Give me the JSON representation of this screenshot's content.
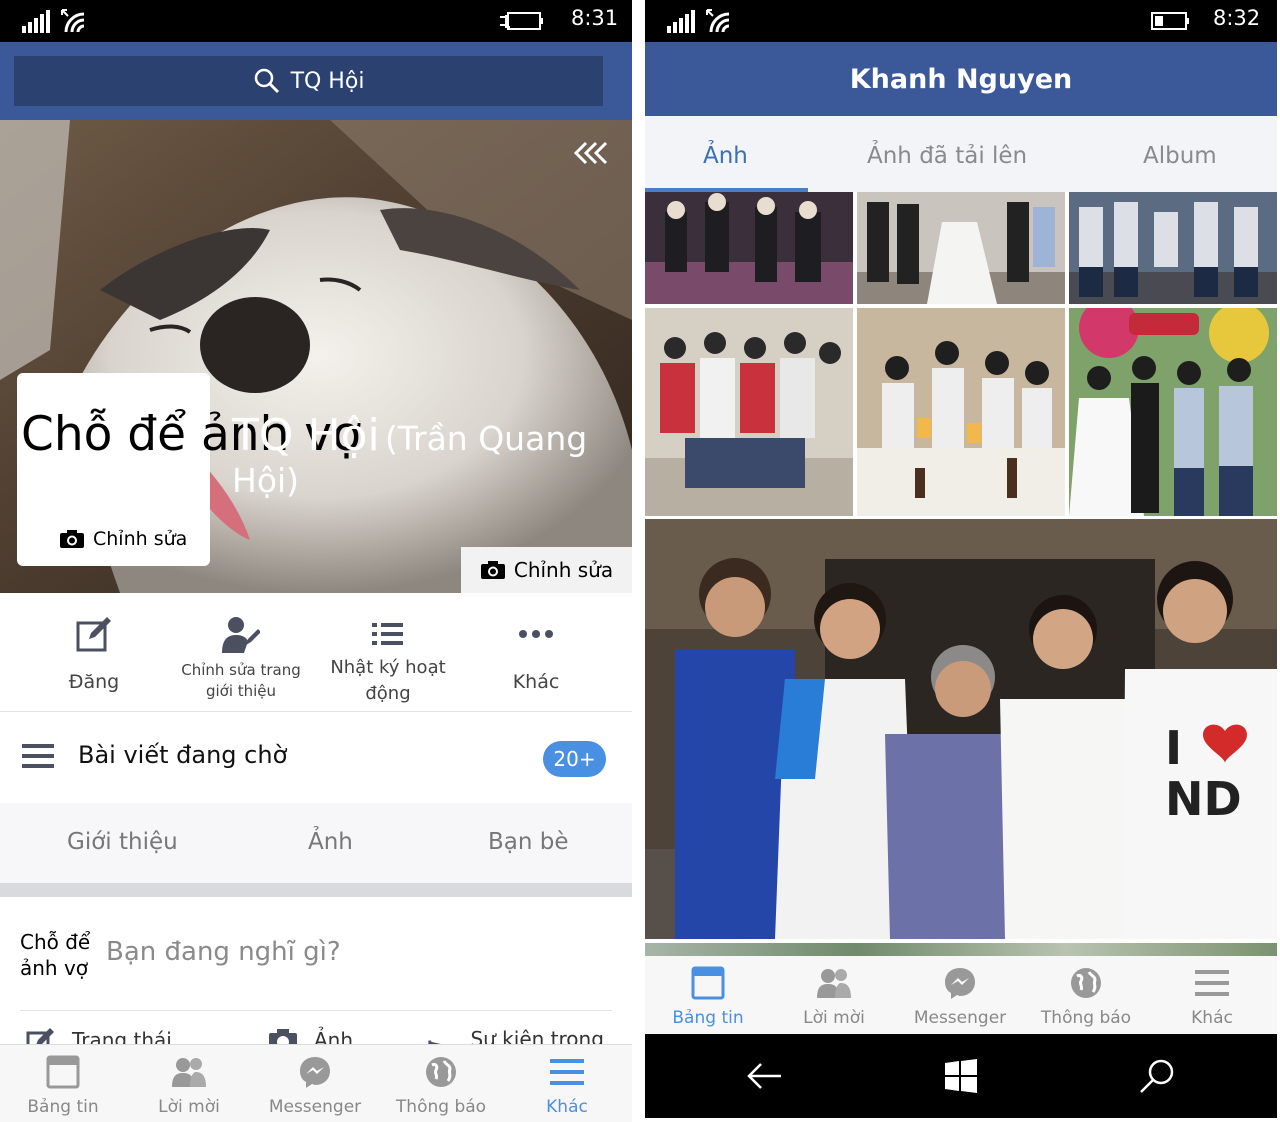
{
  "left": {
    "status": {
      "time": "8:31"
    },
    "search": {
      "label": "TQ Hội"
    },
    "cover": {
      "avatar_placeholder": "Chỗ để ảnh vợ",
      "avatar_edit": "Chỉnh sửa",
      "name": "TQ Hội",
      "alt_name": "(Trần Quang Hội)",
      "cover_edit": "Chỉnh sửa"
    },
    "actions": {
      "post": "Đăng",
      "edit_intro": "Chỉnh sửa trang giới thiệu",
      "activity_log": "Nhật ký hoạt động",
      "more": "Khác"
    },
    "pending": {
      "label": "Bài viết đang chờ",
      "badge": "20+"
    },
    "tabs": {
      "about": "Giới thiệu",
      "photos": "Ảnh",
      "friends": "Bạn bè"
    },
    "composer": {
      "avatar_label": "Chỗ để ảnh vợ",
      "placeholder": "Bạn đang nghĩ gì?",
      "status": "Trạng thái",
      "photo": "Ảnh",
      "life_event": "Sự kiện trong đời"
    },
    "nav": {
      "news_feed": "Bảng tin",
      "requests": "Lời mời",
      "messenger": "Messenger",
      "notifications": "Thông báo",
      "more": "Khác",
      "active": "more"
    }
  },
  "right": {
    "status": {
      "time": "8:32"
    },
    "title": "Khanh Nguyen",
    "tabs": {
      "photos": "Ảnh",
      "uploaded": "Ảnh đã tải lên",
      "album": "Album"
    },
    "nav": {
      "news_feed": "Bảng tin",
      "requests": "Lời mời",
      "messenger": "Messenger",
      "notifications": "Thông báo",
      "more": "Khác",
      "active": "news_feed"
    }
  },
  "colors": {
    "facebook_blue": "#3b5998",
    "search_bar": "#2b4170",
    "accent_blue": "#4a90e2",
    "nav_inactive": "#888888"
  }
}
